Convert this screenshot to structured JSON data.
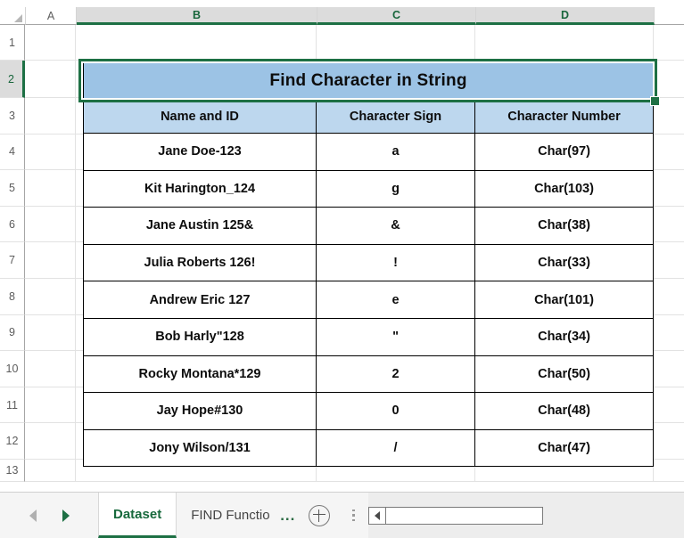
{
  "grid": {
    "column_headers": [
      "A",
      "B",
      "C",
      "D"
    ],
    "selected_columns": [
      "B",
      "C",
      "D"
    ],
    "row_headers": [
      "1",
      "2",
      "3",
      "4",
      "5",
      "6",
      "7",
      "8",
      "9",
      "10",
      "11",
      "12",
      "13"
    ],
    "selected_row": "2",
    "select_all_icon": "select-all-triangle"
  },
  "table": {
    "title": "Find Character in String",
    "headers": [
      "Name and ID",
      "Character Sign",
      "Character Number"
    ],
    "rows": [
      [
        "Jane Doe-123",
        "a",
        "Char(97)"
      ],
      [
        "Kit Harington_124",
        "g",
        "Char(103)"
      ],
      [
        "Jane Austin 125&",
        "&",
        "Char(38)"
      ],
      [
        "Julia Roberts 126!",
        "!",
        "Char(33)"
      ],
      [
        "Andrew Eric 127",
        "e",
        "Char(101)"
      ],
      [
        "Bob Harly\"128",
        "\"",
        "Char(34)"
      ],
      [
        "Rocky Montana*129",
        "2",
        "Char(50)"
      ],
      [
        "Jay Hope#130",
        "0",
        "Char(48)"
      ],
      [
        "Jony Wilson/131",
        "/",
        "Char(47)"
      ]
    ],
    "colors": {
      "title_fill": "#9CC3E5",
      "header_fill": "#BDD7EE",
      "border": "#000000",
      "text": "#0D0D0D"
    }
  },
  "selection": {
    "range": "B2:D2",
    "border_color": "#1D7044",
    "fill_handle": "fill-handle"
  },
  "tabbar": {
    "nav_prev_icon": "triangle-left-icon",
    "nav_next_icon": "triangle-right-icon",
    "tabs": [
      {
        "label": "Dataset",
        "active": true
      },
      {
        "label": "FIND Functio",
        "active": false
      }
    ],
    "overflow_label": "...",
    "add_sheet_icon": "plus-circle-icon",
    "drag_handle_icon": "vertical-dots-icon",
    "hscroll_left_icon": "triangle-left-icon"
  }
}
